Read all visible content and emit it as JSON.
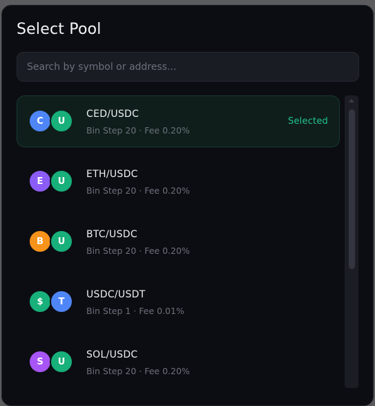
{
  "modal": {
    "title": "Select Pool"
  },
  "search": {
    "placeholder": "Search by symbol or address...",
    "value": ""
  },
  "pools": [
    {
      "name": "CED/USDC",
      "meta": "Bin Step 20 · Fee 0.20%",
      "selected": true,
      "selected_label": "Selected",
      "token1": {
        "letter": "C",
        "color": "#4f86f7"
      },
      "token2": {
        "letter": "U",
        "color": "#18b07b"
      }
    },
    {
      "name": "ETH/USDC",
      "meta": "Bin Step 20 · Fee 0.20%",
      "selected": false,
      "token1": {
        "letter": "E",
        "color": "#8b5cf6"
      },
      "token2": {
        "letter": "U",
        "color": "#18b07b"
      }
    },
    {
      "name": "BTC/USDC",
      "meta": "Bin Step 20 · Fee 0.20%",
      "selected": false,
      "token1": {
        "letter": "B",
        "color": "#f7931a"
      },
      "token2": {
        "letter": "U",
        "color": "#18b07b"
      }
    },
    {
      "name": "USDC/USDT",
      "meta": "Bin Step 1 · Fee 0.01%",
      "selected": false,
      "token1": {
        "letter": "$",
        "color": "#18b07b"
      },
      "token2": {
        "letter": "T",
        "color": "#4f86f7"
      }
    },
    {
      "name": "SOL/USDC",
      "meta": "Bin Step 20 · Fee 0.20%",
      "selected": false,
      "token1": {
        "letter": "S",
        "color": "#a855f7"
      },
      "token2": {
        "letter": "U",
        "color": "#18b07b"
      }
    }
  ]
}
